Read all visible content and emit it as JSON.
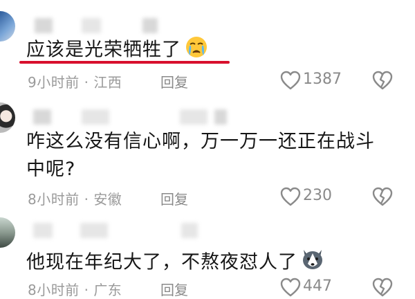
{
  "comments": [
    {
      "text": "应该是光荣牺牲了",
      "emoji": "crying-face",
      "time": "9小时前",
      "location": "江西",
      "reply_label": "回复",
      "likes": "1387"
    },
    {
      "text_line1": "咋这么没有信心啊，万一万一还正在战斗",
      "text_line2": "中呢?",
      "time": "8小时前",
      "location": "安徽",
      "reply_label": "回复",
      "likes": "230"
    },
    {
      "text": "他现在年纪大了，不熬夜怼人了",
      "emoji": "husky-dog-face",
      "time": "8小时前",
      "location": "广东",
      "reply_label": "回复",
      "likes": "447"
    }
  ],
  "separator": "·",
  "colors": {
    "underline": "#d8102d",
    "meta_text": "#9a9a9a",
    "body_text": "#161616"
  }
}
